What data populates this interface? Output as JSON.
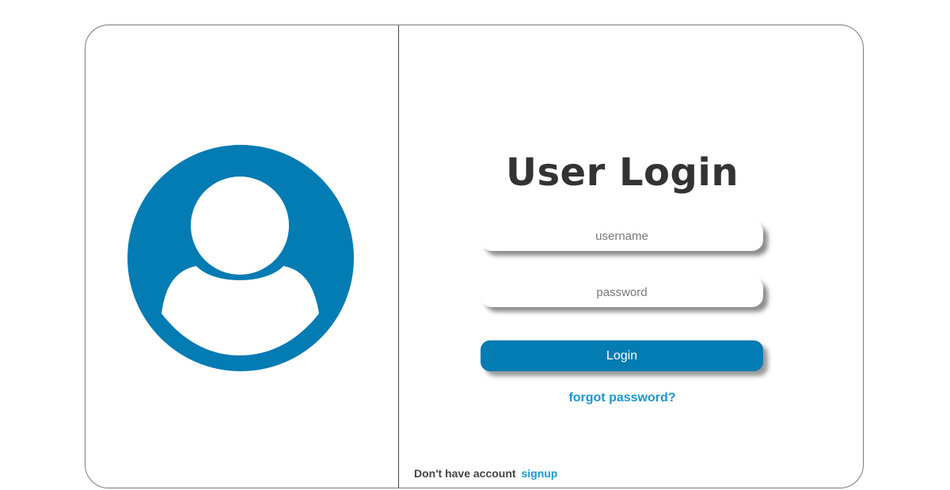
{
  "login": {
    "title": "User Login",
    "username_placeholder": "username",
    "password_placeholder": "password",
    "login_label": "Login",
    "forgot_label": "forgot password?",
    "no_account_text": "Don't have account",
    "signup_label": "signup"
  },
  "icons": {
    "avatar": "user-avatar-icon"
  },
  "colors": {
    "accent": "#037bb3",
    "link": "#1a97cf",
    "title": "#333333",
    "border": "#7a7a7a"
  }
}
